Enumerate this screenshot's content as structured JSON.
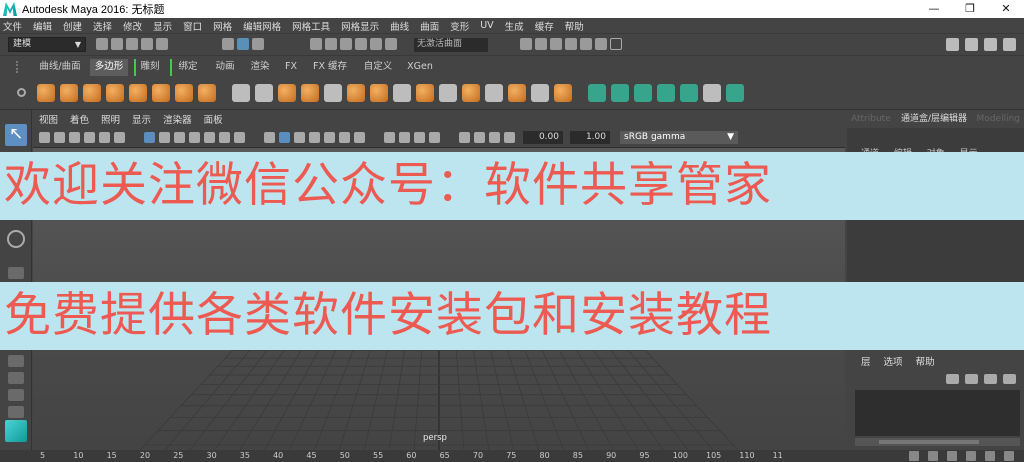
{
  "window": {
    "title": "Autodesk Maya 2016: 无标题",
    "controls": [
      "—",
      "❐",
      "✕"
    ]
  },
  "menubar": [
    "文件",
    "编辑",
    "创建",
    "选择",
    "修改",
    "显示",
    "窗口",
    "网格",
    "编辑网格",
    "网格工具",
    "网格显示",
    "曲线",
    "曲面",
    "变形",
    "UV",
    "生成",
    "缓存",
    "帮助"
  ],
  "statusline": {
    "mode": "建模",
    "object_field": "无激活曲面"
  },
  "shelf_tabs": [
    "曲线/曲面",
    "多边形",
    "雕刻",
    "绑定",
    "动画",
    "渲染",
    "FX",
    "FX 缓存",
    "自定义",
    "XGen"
  ],
  "shelf_tab_active": 1,
  "viewport": {
    "menu": [
      "视图",
      "着色",
      "照明",
      "显示",
      "渲染器",
      "面板"
    ],
    "exposure": "0.00",
    "gamma_value": "1.00",
    "color_space": "sRGB gamma",
    "camera_label": "persp"
  },
  "channel_box": {
    "header": "通道盒/层编辑器",
    "header_left": "Attribute",
    "header_right": "Modelling",
    "tabs": [
      "通道",
      "编辑",
      "对象",
      "显示"
    ]
  },
  "layer_editor": {
    "tabs": [
      "层",
      "选项",
      "帮助"
    ]
  },
  "time_slider": {
    "ticks": [
      "5",
      "10",
      "15",
      "20",
      "25",
      "30",
      "35",
      "40",
      "45",
      "50",
      "55",
      "60",
      "65",
      "70",
      "75",
      "80",
      "85",
      "90",
      "95",
      "100",
      "105",
      "110",
      "11"
    ]
  },
  "overlay": {
    "line1": "欢迎关注微信公众号：软件共享管家",
    "line2": "免费提供各类软件安装包和安装教程",
    "bg_color": "#bde5ef",
    "text_color": "#ec5a52"
  },
  "colors": {
    "ui_bg": "#444444",
    "accent_blue": "#5d8fc3",
    "shelf_orange": "#e39440",
    "shelf_teal": "#36a58c",
    "tab_marker_green": "#46c84a"
  }
}
